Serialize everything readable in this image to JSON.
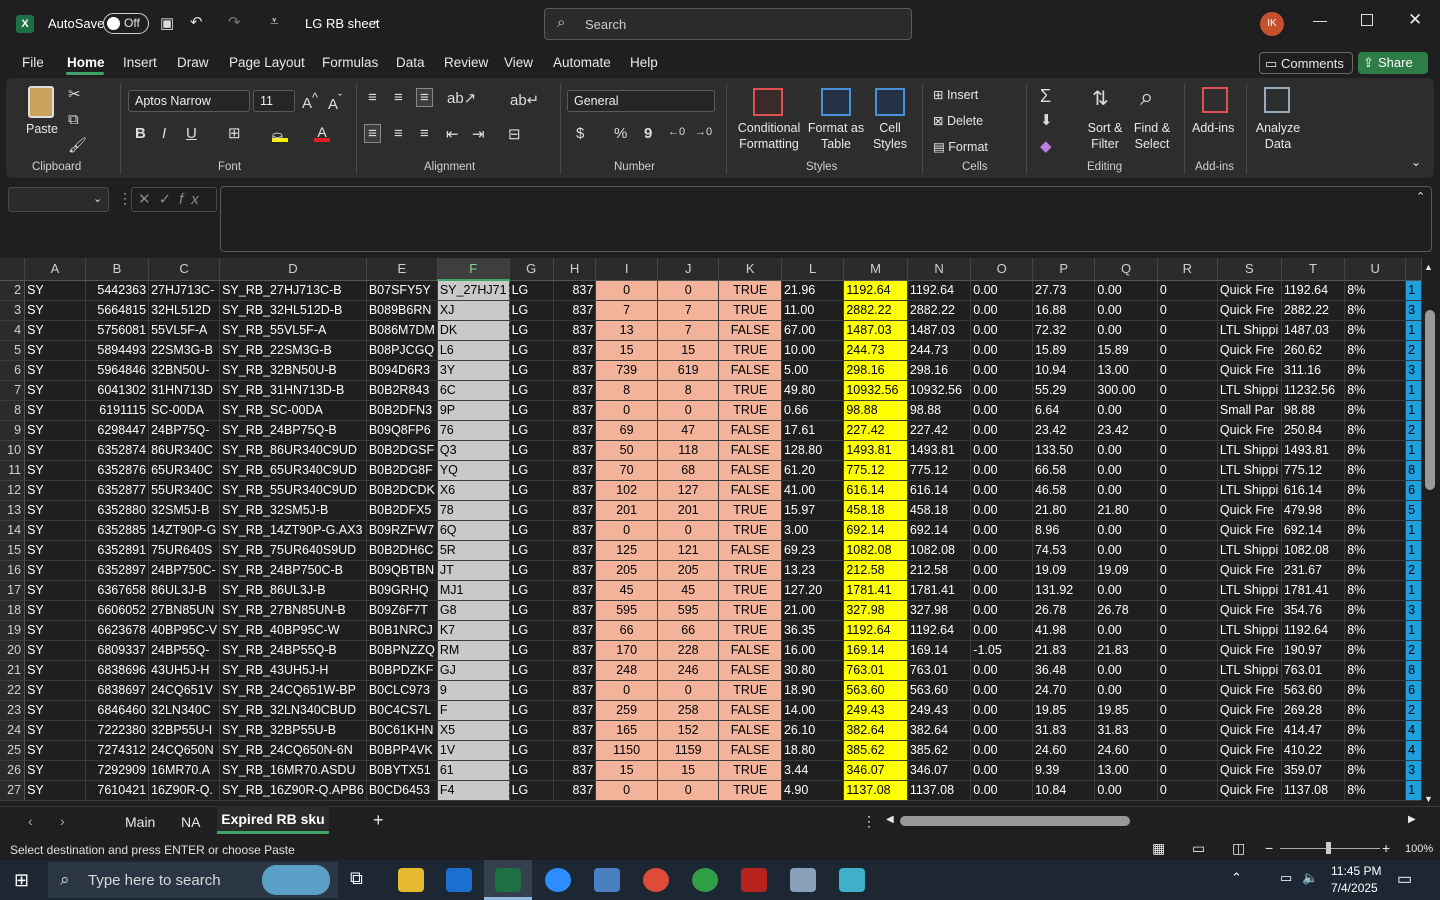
{
  "app": {
    "autosave_label": "AutoSave",
    "autosave_state": "Off",
    "file_name": "LG RB sheet",
    "search_placeholder": "Search",
    "user_initials": "IK"
  },
  "menu": [
    "File",
    "Home",
    "Insert",
    "Draw",
    "Page Layout",
    "Formulas",
    "Data",
    "Review",
    "View",
    "Automate",
    "Help"
  ],
  "buttons": {
    "comments": "Comments",
    "share": "Share"
  },
  "ribbon": {
    "clipboard": {
      "paste": "Paste",
      "label": "Clipboard"
    },
    "font": {
      "name": "Aptos Narrow",
      "size": "11",
      "label": "Font",
      "bold": "B",
      "italic": "I",
      "underline": "U"
    },
    "alignment": {
      "label": "Alignment"
    },
    "number": {
      "format": "General",
      "label": "Number",
      "currency": "$",
      "percent": "%",
      "comma": "9"
    },
    "styles": {
      "conditional": [
        "Conditional",
        "Formatting"
      ],
      "format_table": [
        "Format as",
        "Table"
      ],
      "cell_styles": [
        "Cell",
        "Styles"
      ],
      "label": "Styles"
    },
    "cells": {
      "insert": "Insert",
      "delete": "Delete",
      "format": "Format",
      "label": "Cells"
    },
    "editing": {
      "sort": [
        "Sort &",
        "Filter"
      ],
      "find": [
        "Find &",
        "Select"
      ],
      "label": "Editing"
    },
    "addins": {
      "addins": "Add-ins",
      "label": "Add-ins",
      "analyze": [
        "Analyze",
        "Data"
      ]
    }
  },
  "columns": [
    "A",
    "B",
    "C",
    "D",
    "E",
    "F",
    "G",
    "H",
    "I",
    "J",
    "K",
    "L",
    "M",
    "N",
    "O",
    "P",
    "Q",
    "R",
    "S",
    "T",
    "U"
  ],
  "rows": [
    {
      "n": "2",
      "a": "SY",
      "b": "5442363",
      "c": "27HJ713C-",
      "d": "SY_RB_27HJ713C-B",
      "e": "B07SFY5Y",
      "f": "SY_27HJ71",
      "g": "LG",
      "h": "837",
      "i": "0",
      "j": "0",
      "k": "TRUE",
      "l": "21.96",
      "m": "1192.64",
      "nn": "1192.64",
      "o": "0.00",
      "p": "27.73",
      "q": "0.00",
      "r": "0",
      "s": "Quick Fre",
      "t": "1192.64",
      "u": "8%",
      "v": "1"
    },
    {
      "n": "3",
      "a": "SY",
      "b": "5664815",
      "c": "32HL512D",
      "d": "SY_RB_32HL512D-B",
      "e": "B089B6RN",
      "f": "XJ",
      "g": "LG",
      "h": "837",
      "i": "7",
      "j": "7",
      "k": "TRUE",
      "l": "11.00",
      "m": "2882.22",
      "nn": "2882.22",
      "o": "0.00",
      "p": "16.88",
      "q": "0.00",
      "r": "0",
      "s": "Quick Fre",
      "t": "2882.22",
      "u": "8%",
      "v": "3"
    },
    {
      "n": "4",
      "a": "SY",
      "b": "5756081",
      "c": "55VL5F-A",
      "d": "SY_RB_55VL5F-A",
      "e": "B086M7DM",
      "f": "DK",
      "g": "LG",
      "h": "837",
      "i": "13",
      "j": "7",
      "k": "FALSE",
      "l": "67.00",
      "m": "1487.03",
      "nn": "1487.03",
      "o": "0.00",
      "p": "72.32",
      "q": "0.00",
      "r": "0",
      "s": "LTL Shippi",
      "t": "1487.03",
      "u": "8%",
      "v": "1"
    },
    {
      "n": "5",
      "a": "SY",
      "b": "5894493",
      "c": "22SM3G-B",
      "d": "SY_RB_22SM3G-B",
      "e": "B08PJCGQ",
      "f": "L6",
      "g": "LG",
      "h": "837",
      "i": "15",
      "j": "15",
      "k": "TRUE",
      "l": "10.00",
      "m": "244.73",
      "nn": "244.73",
      "o": "0.00",
      "p": "15.89",
      "q": "15.89",
      "r": "0",
      "s": "Quick Fre",
      "t": "260.62",
      "u": "8%",
      "v": "2"
    },
    {
      "n": "6",
      "a": "SY",
      "b": "5964846",
      "c": "32BN50U-",
      "d": "SY_RB_32BN50U-B",
      "e": "B094D6R3",
      "f": "3Y",
      "g": "LG",
      "h": "837",
      "i": "739",
      "j": "619",
      "k": "FALSE",
      "l": "5.00",
      "m": "298.16",
      "nn": "298.16",
      "o": "0.00",
      "p": "10.94",
      "q": "13.00",
      "r": "0",
      "s": "Quick Fre",
      "t": "311.16",
      "u": "8%",
      "v": "3"
    },
    {
      "n": "7",
      "a": "SY",
      "b": "6041302",
      "c": "31HN713D",
      "d": "SY_RB_31HN713D-B",
      "e": "B0B2R843",
      "f": "6C",
      "g": "LG",
      "h": "837",
      "i": "8",
      "j": "8",
      "k": "TRUE",
      "l": "49.80",
      "m": "10932.56",
      "nn": "10932.56",
      "o": "0.00",
      "p": "55.29",
      "q": "300.00",
      "r": "0",
      "s": "LTL Shippi",
      "t": "11232.56",
      "u": "8%",
      "v": "1"
    },
    {
      "n": "8",
      "a": "SY",
      "b": "6191115",
      "c": "SC-00DA",
      "d": "SY_RB_SC-00DA",
      "e": "B0B2DFN3",
      "f": "9P",
      "g": "LG",
      "h": "837",
      "i": "0",
      "j": "0",
      "k": "TRUE",
      "l": "0.66",
      "m": "98.88",
      "nn": "98.88",
      "o": "0.00",
      "p": "6.64",
      "q": "0.00",
      "r": "0",
      "s": "Small Par",
      "t": "98.88",
      "u": "8%",
      "v": "1"
    },
    {
      "n": "9",
      "a": "SY",
      "b": "6298447",
      "c": "24BP75Q-",
      "d": "SY_RB_24BP75Q-B",
      "e": "B09Q8FP6",
      "f": "76",
      "g": "LG",
      "h": "837",
      "i": "69",
      "j": "47",
      "k": "FALSE",
      "l": "17.61",
      "m": "227.42",
      "nn": "227.42",
      "o": "0.00",
      "p": "23.42",
      "q": "23.42",
      "r": "0",
      "s": "Quick Fre",
      "t": "250.84",
      "u": "8%",
      "v": "2"
    },
    {
      "n": "10",
      "a": "SY",
      "b": "6352874",
      "c": "86UR340C",
      "d": "SY_RB_86UR340C9UD",
      "e": "B0B2DGSF",
      "f": "Q3",
      "g": "LG",
      "h": "837",
      "i": "50",
      "j": "118",
      "k": "FALSE",
      "l": "128.80",
      "m": "1493.81",
      "nn": "1493.81",
      "o": "0.00",
      "p": "133.50",
      "q": "0.00",
      "r": "0",
      "s": "LTL Shippi",
      "t": "1493.81",
      "u": "8%",
      "v": "1"
    },
    {
      "n": "11",
      "a": "SY",
      "b": "6352876",
      "c": "65UR340C",
      "d": "SY_RB_65UR340C9UD",
      "e": "B0B2DG8F",
      "f": "YQ",
      "g": "LG",
      "h": "837",
      "i": "70",
      "j": "68",
      "k": "FALSE",
      "l": "61.20",
      "m": "775.12",
      "nn": "775.12",
      "o": "0.00",
      "p": "66.58",
      "q": "0.00",
      "r": "0",
      "s": "LTL Shippi",
      "t": "775.12",
      "u": "8%",
      "v": "8"
    },
    {
      "n": "12",
      "a": "SY",
      "b": "6352877",
      "c": "55UR340C",
      "d": "SY_RB_55UR340C9UD",
      "e": "B0B2DCDK",
      "f": "X6",
      "g": "LG",
      "h": "837",
      "i": "102",
      "j": "127",
      "k": "FALSE",
      "l": "41.00",
      "m": "616.14",
      "nn": "616.14",
      "o": "0.00",
      "p": "46.58",
      "q": "0.00",
      "r": "0",
      "s": "LTL Shippi",
      "t": "616.14",
      "u": "8%",
      "v": "6"
    },
    {
      "n": "13",
      "a": "SY",
      "b": "6352880",
      "c": "32SM5J-B",
      "d": "SY_RB_32SM5J-B",
      "e": "B0B2DFX5",
      "f": "78",
      "g": "LG",
      "h": "837",
      "i": "201",
      "j": "201",
      "k": "TRUE",
      "l": "15.97",
      "m": "458.18",
      "nn": "458.18",
      "o": "0.00",
      "p": "21.80",
      "q": "21.80",
      "r": "0",
      "s": "Quick Fre",
      "t": "479.98",
      "u": "8%",
      "v": "5"
    },
    {
      "n": "14",
      "a": "SY",
      "b": "6352885",
      "c": "14ZT90P-G",
      "d": "SY_RB_14ZT90P-G.AX3",
      "e": "B09RZFW7",
      "f": "6Q",
      "g": "LG",
      "h": "837",
      "i": "0",
      "j": "0",
      "k": "TRUE",
      "l": "3.00",
      "m": "692.14",
      "nn": "692.14",
      "o": "0.00",
      "p": "8.96",
      "q": "0.00",
      "r": "0",
      "s": "Quick Fre",
      "t": "692.14",
      "u": "8%",
      "v": "1"
    },
    {
      "n": "15",
      "a": "SY",
      "b": "6352891",
      "c": "75UR640S",
      "d": "SY_RB_75UR640S9UD",
      "e": "B0B2DH6C",
      "f": "5R",
      "g": "LG",
      "h": "837",
      "i": "125",
      "j": "121",
      "k": "FALSE",
      "l": "69.23",
      "m": "1082.08",
      "nn": "1082.08",
      "o": "0.00",
      "p": "74.53",
      "q": "0.00",
      "r": "0",
      "s": "LTL Shippi",
      "t": "1082.08",
      "u": "8%",
      "v": "1"
    },
    {
      "n": "16",
      "a": "SY",
      "b": "6352897",
      "c": "24BP750C-",
      "d": "SY_RB_24BP750C-B",
      "e": "B09QBTBN",
      "f": "JT",
      "g": "LG",
      "h": "837",
      "i": "205",
      "j": "205",
      "k": "TRUE",
      "l": "13.23",
      "m": "212.58",
      "nn": "212.58",
      "o": "0.00",
      "p": "19.09",
      "q": "19.09",
      "r": "0",
      "s": "Quick Fre",
      "t": "231.67",
      "u": "8%",
      "v": "2"
    },
    {
      "n": "17",
      "a": "SY",
      "b": "6367658",
      "c": "86UL3J-B",
      "d": "SY_RB_86UL3J-B",
      "e": "B09GRHQ",
      "f": "MJ1",
      "g": "LG",
      "h": "837",
      "i": "45",
      "j": "45",
      "k": "TRUE",
      "l": "127.20",
      "m": "1781.41",
      "nn": "1781.41",
      "o": "0.00",
      "p": "131.92",
      "q": "0.00",
      "r": "0",
      "s": "LTL Shippi",
      "t": "1781.41",
      "u": "8%",
      "v": "1"
    },
    {
      "n": "18",
      "a": "SY",
      "b": "6606052",
      "c": "27BN85UN",
      "d": "SY_RB_27BN85UN-B",
      "e": "B09Z6F7T",
      "f": "G8",
      "g": "LG",
      "h": "837",
      "i": "595",
      "j": "595",
      "k": "TRUE",
      "l": "21.00",
      "m": "327.98",
      "nn": "327.98",
      "o": "0.00",
      "p": "26.78",
      "q": "26.78",
      "r": "0",
      "s": "Quick Fre",
      "t": "354.76",
      "u": "8%",
      "v": "3"
    },
    {
      "n": "19",
      "a": "SY",
      "b": "6623678",
      "c": "40BP95C-V",
      "d": "SY_RB_40BP95C-W",
      "e": "B0B1NRCJ",
      "f": "K7",
      "g": "LG",
      "h": "837",
      "i": "66",
      "j": "66",
      "k": "TRUE",
      "l": "36.35",
      "m": "1192.64",
      "nn": "1192.64",
      "o": "0.00",
      "p": "41.98",
      "q": "0.00",
      "r": "0",
      "s": "LTL Shippi",
      "t": "1192.64",
      "u": "8%",
      "v": "1"
    },
    {
      "n": "20",
      "a": "SY",
      "b": "6809337",
      "c": "24BP55Q-",
      "d": "SY_RB_24BP55Q-B",
      "e": "B0BPNZZQ",
      "f": "RM",
      "g": "LG",
      "h": "837",
      "i": "170",
      "j": "228",
      "k": "FALSE",
      "l": "16.00",
      "m": "169.14",
      "nn": "169.14",
      "o": "-1.05",
      "p": "21.83",
      "q": "21.83",
      "r": "0",
      "s": "Quick Fre",
      "t": "190.97",
      "u": "8%",
      "v": "2"
    },
    {
      "n": "21",
      "a": "SY",
      "b": "6838696",
      "c": "43UH5J-H",
      "d": "SY_RB_43UH5J-H",
      "e": "B0BPDZKF",
      "f": "GJ",
      "g": "LG",
      "h": "837",
      "i": "248",
      "j": "246",
      "k": "FALSE",
      "l": "30.80",
      "m": "763.01",
      "nn": "763.01",
      "o": "0.00",
      "p": "36.48",
      "q": "0.00",
      "r": "0",
      "s": "LTL Shippi",
      "t": "763.01",
      "u": "8%",
      "v": "8"
    },
    {
      "n": "22",
      "a": "SY",
      "b": "6838697",
      "c": "24CQ651V",
      "d": "SY_RB_24CQ651W-BP",
      "e": "B0CLC973",
      "f": "9",
      "g": "LG",
      "h": "837",
      "i": "0",
      "j": "0",
      "k": "TRUE",
      "l": "18.90",
      "m": "563.60",
      "nn": "563.60",
      "o": "0.00",
      "p": "24.70",
      "q": "0.00",
      "r": "0",
      "s": "Quick Fre",
      "t": "563.60",
      "u": "8%",
      "v": "6"
    },
    {
      "n": "23",
      "a": "SY",
      "b": "6846460",
      "c": "32LN340C",
      "d": "SY_RB_32LN340CBUD",
      "e": "B0C4CS7L",
      "f": "F",
      "g": "LG",
      "h": "837",
      "i": "259",
      "j": "258",
      "k": "FALSE",
      "l": "14.00",
      "m": "249.43",
      "nn": "249.43",
      "o": "0.00",
      "p": "19.85",
      "q": "19.85",
      "r": "0",
      "s": "Quick Fre",
      "t": "269.28",
      "u": "8%",
      "v": "2"
    },
    {
      "n": "24",
      "a": "SY",
      "b": "7222380",
      "c": "32BP55U-I",
      "d": "SY_RB_32BP55U-B",
      "e": "B0C61KHN",
      "f": "X5",
      "g": "LG",
      "h": "837",
      "i": "165",
      "j": "152",
      "k": "FALSE",
      "l": "26.10",
      "m": "382.64",
      "nn": "382.64",
      "o": "0.00",
      "p": "31.83",
      "q": "31.83",
      "r": "0",
      "s": "Quick Fre",
      "t": "414.47",
      "u": "8%",
      "v": "4"
    },
    {
      "n": "25",
      "a": "SY",
      "b": "7274312",
      "c": "24CQ650N",
      "d": "SY_RB_24CQ650N-6N",
      "e": "B0BPP4VK",
      "f": "1V",
      "g": "LG",
      "h": "837",
      "i": "1150",
      "j": "1159",
      "k": "FALSE",
      "l": "18.80",
      "m": "385.62",
      "nn": "385.62",
      "o": "0.00",
      "p": "24.60",
      "q": "24.60",
      "r": "0",
      "s": "Quick Fre",
      "t": "410.22",
      "u": "8%",
      "v": "4"
    },
    {
      "n": "26",
      "a": "SY",
      "b": "7292909",
      "c": "16MR70.A",
      "d": "SY_RB_16MR70.ASDU",
      "e": "B0BYTX51",
      "f": "61",
      "g": "LG",
      "h": "837",
      "i": "15",
      "j": "15",
      "k": "TRUE",
      "l": "3.44",
      "m": "346.07",
      "nn": "346.07",
      "o": "0.00",
      "p": "9.39",
      "q": "13.00",
      "r": "0",
      "s": "Quick Fre",
      "t": "359.07",
      "u": "8%",
      "v": "3"
    },
    {
      "n": "27",
      "a": "SY",
      "b": "7610421",
      "c": "16Z90R-Q.",
      "d": "SY_RB_16Z90R-Q.APB6",
      "e": "B0CD6453",
      "f": "F4",
      "g": "LG",
      "h": "837",
      "i": "0",
      "j": "0",
      "k": "TRUE",
      "l": "4.90",
      "m": "1137.08",
      "nn": "1137.08",
      "o": "0.00",
      "p": "10.84",
      "q": "0.00",
      "r": "0",
      "s": "Quick Fre",
      "t": "1137.08",
      "u": "8%",
      "v": "1"
    }
  ],
  "sheets": [
    "Main",
    "NA",
    "Expired RB sku"
  ],
  "status_text": "Select destination and press ENTER or choose Paste",
  "zoom": "100%",
  "taskbar": {
    "search_placeholder": "Type here to search",
    "time": "11:45 PM",
    "date": "7/4/2025"
  }
}
